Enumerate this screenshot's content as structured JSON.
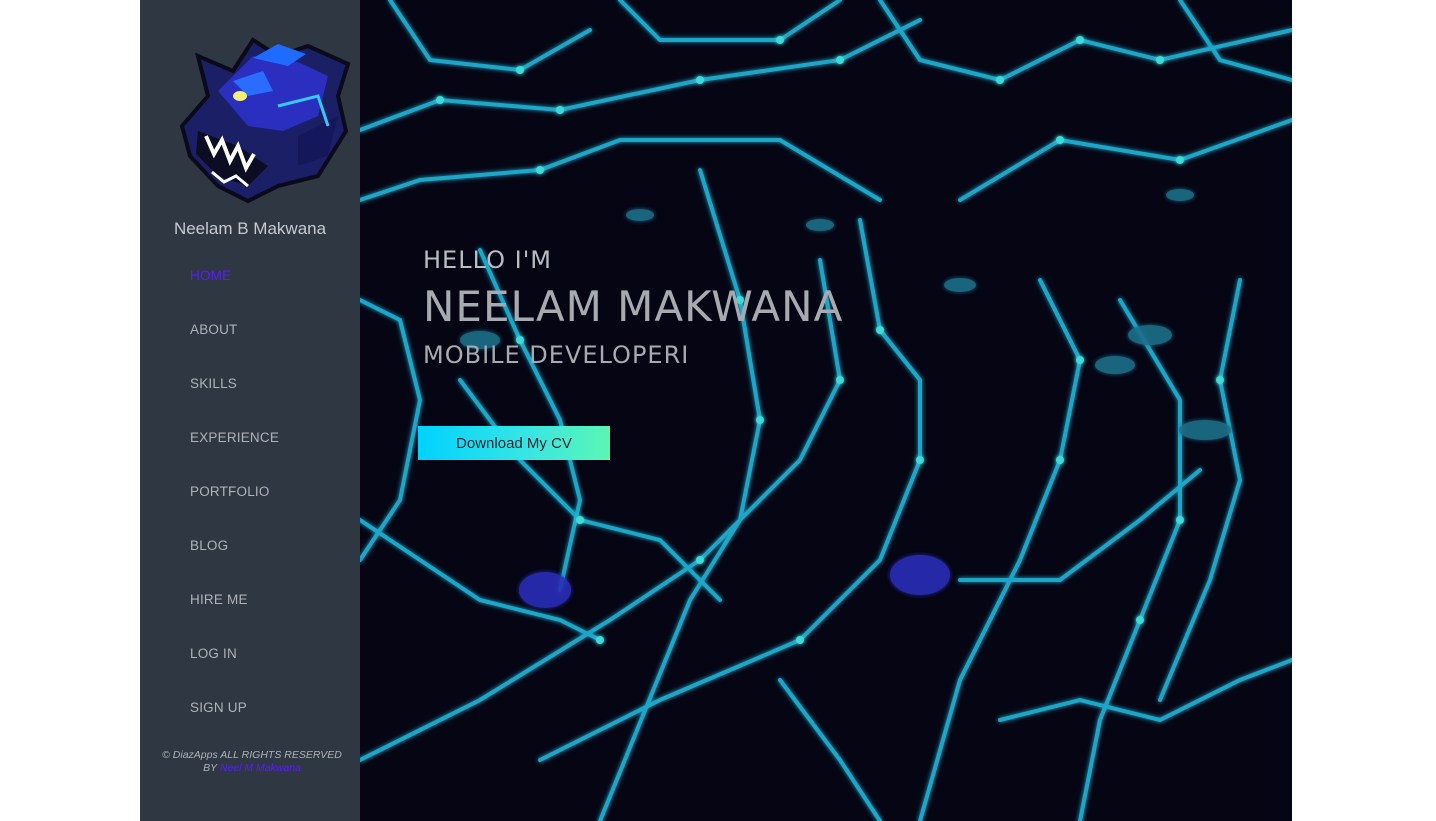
{
  "sidebar": {
    "site_name": "Neelam B Makwana",
    "logo_icon": "panther-mascot-logo",
    "nav": [
      {
        "label": "HOME",
        "active": true
      },
      {
        "label": "ABOUT",
        "active": false
      },
      {
        "label": "SKILLS",
        "active": false
      },
      {
        "label": "EXPERIENCE",
        "active": false
      },
      {
        "label": "PORTFOLIO",
        "active": false
      },
      {
        "label": "BLOG",
        "active": false
      },
      {
        "label": "HIRE ME",
        "active": false
      },
      {
        "label": "LOG IN",
        "active": false
      },
      {
        "label": "SIGN UP",
        "active": false
      }
    ],
    "footer_text": "© DiazApps ALL RIGHTS RESERVED BY",
    "footer_link": "Neel M Makwana"
  },
  "hero": {
    "greeting": "HELLO I'M",
    "name": "NEELAM MAKWANA",
    "role": "MOBILE DEVELOPERI",
    "cv_button": "Download My CV",
    "background": "circuit-board-image"
  },
  "colors": {
    "sidebar_bg": "#2f3742",
    "accent": "#5a1cff",
    "hero_bg": "#060616",
    "button_gradient_start": "#00d2ff",
    "button_gradient_end": "#5cf6b4"
  }
}
